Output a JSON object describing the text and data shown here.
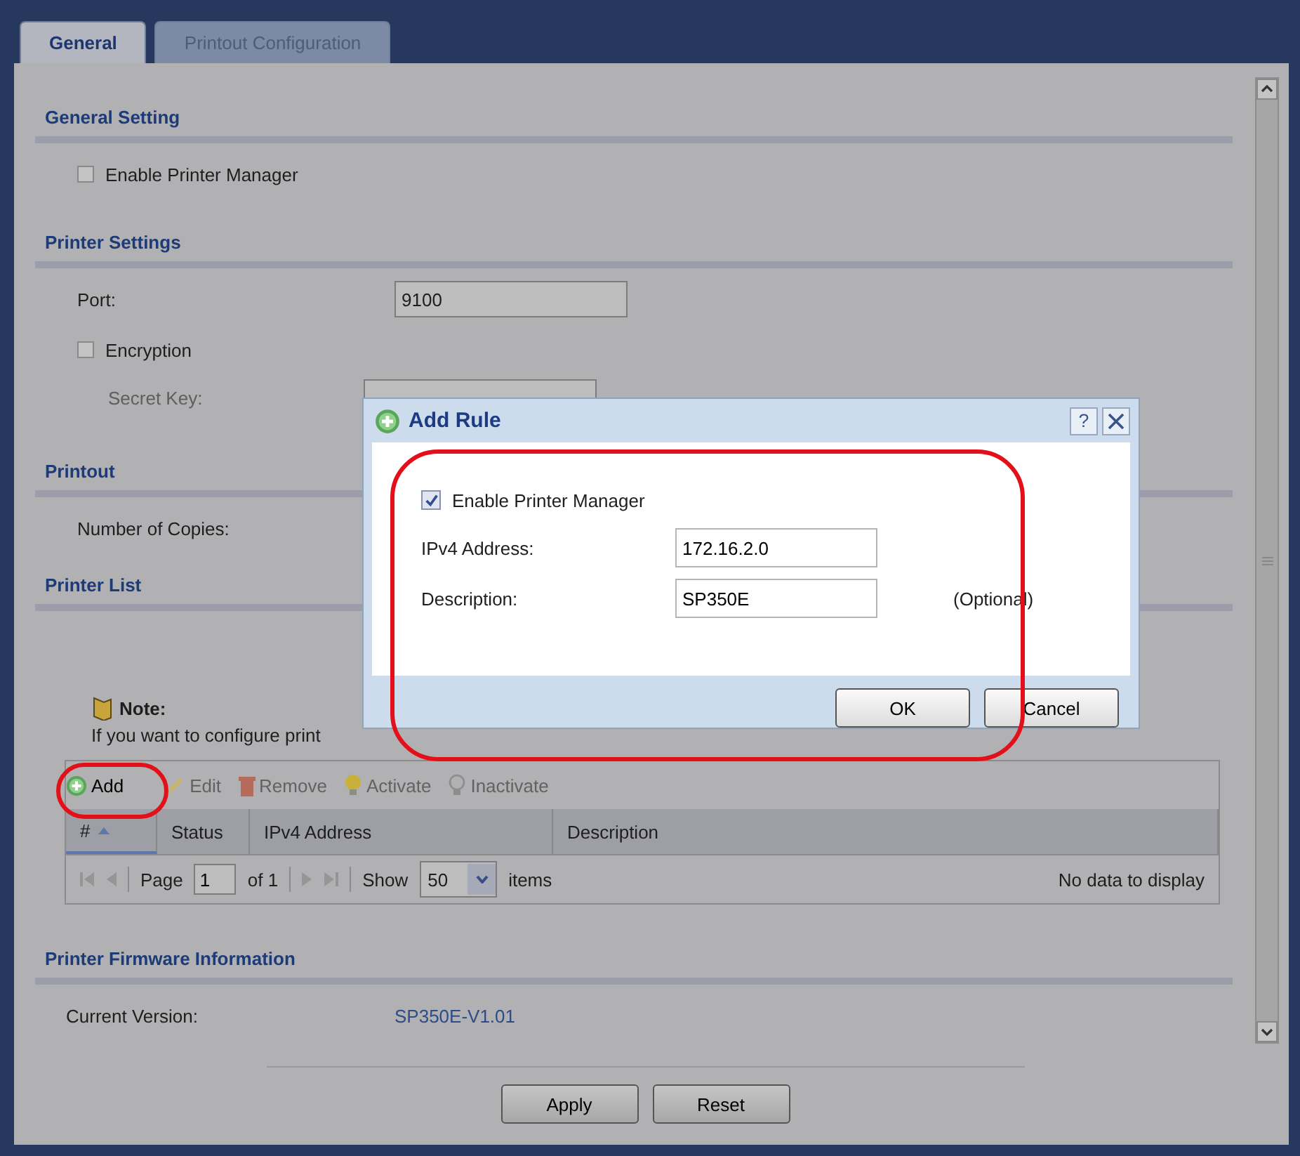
{
  "tabs": [
    {
      "label": "General",
      "selected": true
    },
    {
      "label": "Printout Configuration",
      "selected": false
    }
  ],
  "general_setting": {
    "title": "General Setting",
    "enable": {
      "label": "Enable Printer Manager",
      "checked": false
    }
  },
  "printer_settings": {
    "title": "Printer Settings",
    "port": {
      "label": "Port:",
      "value": "9100"
    },
    "encryption": {
      "label": "Encryption",
      "checked": false
    },
    "secret_key": {
      "label": "Secret Key:",
      "disabled": true
    }
  },
  "printout": {
    "title": "Printout",
    "copies_label": "Number of Copies:"
  },
  "printer_list": {
    "title": "Printer List",
    "note_title": "Note:",
    "note_text": "If you want to configure print",
    "toolbar": [
      {
        "kind": "add",
        "label": "Add",
        "disabled": false
      },
      {
        "kind": "edit",
        "label": "Edit",
        "disabled": true
      },
      {
        "kind": "remove",
        "label": "Remove",
        "disabled": true
      },
      {
        "kind": "activate",
        "label": "Activate",
        "disabled": true
      },
      {
        "kind": "inactivate",
        "label": "Inactivate",
        "disabled": true
      }
    ],
    "columns": [
      {
        "label": "#",
        "sorted": true
      },
      {
        "label": "Status",
        "sorted": false
      },
      {
        "label": "IPv4 Address",
        "sorted": false
      },
      {
        "label": "Description",
        "sorted": false
      }
    ],
    "pager": {
      "page_label": "Page",
      "page": "1",
      "of": "of 1",
      "show_label": "Show",
      "show": "50",
      "items": "items"
    },
    "empty_text": "No data to display"
  },
  "firmware": {
    "title": "Printer Firmware Information",
    "label": "Current Version:",
    "value": "SP350E-V1.01"
  },
  "buttons": [
    "Apply",
    "Reset"
  ],
  "dialog": {
    "title": "Add Rule",
    "help": "?",
    "enable": {
      "label": "Enable Printer Manager",
      "checked": true
    },
    "fields": [
      {
        "label": "IPv4 Address:",
        "value": "172.16.2.0"
      },
      {
        "label": "Description:",
        "value": "SP350E",
        "hint": "(Optional)"
      }
    ],
    "buttons": [
      "OK",
      "Cancel"
    ]
  }
}
